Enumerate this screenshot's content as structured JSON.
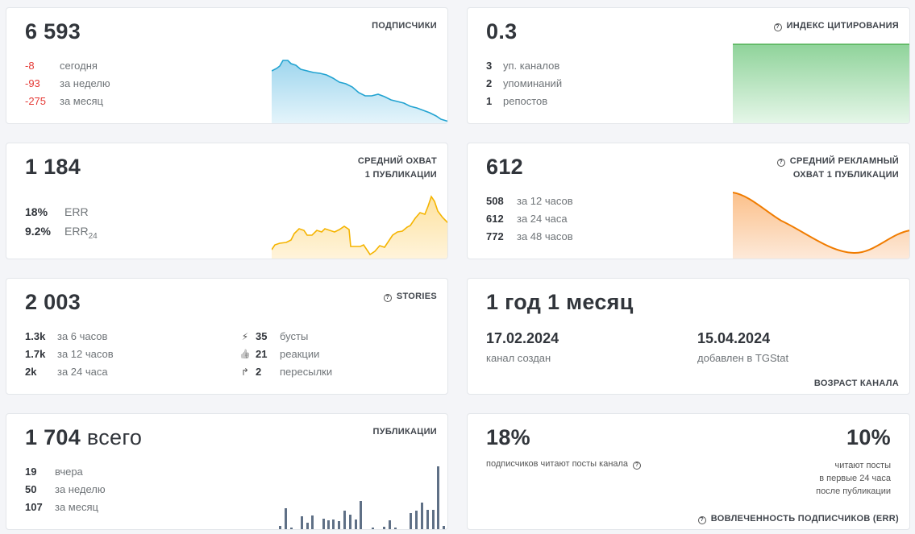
{
  "subscribers": {
    "value": "6 593",
    "label": "ПОДПИСЧИКИ",
    "rows": [
      {
        "n": "-8",
        "t": "сегодня"
      },
      {
        "n": "-93",
        "t": "за неделю"
      },
      {
        "n": "-275",
        "t": "за месяц"
      }
    ],
    "color": "#22a3d1"
  },
  "citation": {
    "value": "0.3",
    "label": "ИНДЕКС ЦИТИРОВАНИЯ",
    "rows": [
      {
        "n": "3",
        "t": "уп. каналов"
      },
      {
        "n": "2",
        "t": "упоминаний"
      },
      {
        "n": "1",
        "t": "репостов"
      }
    ],
    "color": "#4caf50"
  },
  "reach": {
    "value": "1 184",
    "label_line1": "СРЕДНИЙ ОХВАТ",
    "label_line2": "1 ПУБЛИКАЦИИ",
    "rows": [
      {
        "n": "18%",
        "t": "ERR"
      },
      {
        "n": "9.2%",
        "t": "ERR",
        "sub": "24"
      }
    ],
    "color": "#f5b400"
  },
  "ad_reach": {
    "value": "612",
    "label_line1": "СРЕДНИЙ РЕКЛАМНЫЙ",
    "label_line2": "ОХВАТ 1 ПУБЛИКАЦИИ",
    "rows": [
      {
        "n": "508",
        "t": "за 12 часов"
      },
      {
        "n": "612",
        "t": "за 24 часа"
      },
      {
        "n": "772",
        "t": "за 48 часов"
      }
    ],
    "color": "#f07c00"
  },
  "stories": {
    "value": "2 003",
    "label": "STORIES",
    "rows_left": [
      {
        "n": "1.3k",
        "t": "за 6 часов"
      },
      {
        "n": "1.7k",
        "t": "за 12 часов"
      },
      {
        "n": "2k",
        "t": "за 24 часа"
      }
    ],
    "rows_right": [
      {
        "icon": "⚡",
        "icon_name": "lightning-icon",
        "n": "35",
        "t": "бусты"
      },
      {
        "icon": "👍",
        "icon_name": "thumbs-up-icon",
        "n": "21",
        "t": "реакции"
      },
      {
        "icon": "↱",
        "icon_name": "forward-arrow-icon",
        "n": "2",
        "t": "пересылки"
      }
    ]
  },
  "age": {
    "value": "1 год 1 месяц",
    "created_date": "17.02.2024",
    "created_label": "канал создан",
    "added_date": "15.04.2024",
    "added_label": "добавлен в TGStat",
    "label": "ВОЗРАСТ КАНАЛА"
  },
  "posts": {
    "value": "1 704",
    "value_suffix": "всего",
    "label": "ПУБЛИКАЦИИ",
    "rows": [
      {
        "n": "19",
        "t": "вчера"
      },
      {
        "n": "50",
        "t": "за неделю"
      },
      {
        "n": "107",
        "t": "за месяц"
      }
    ],
    "color": "#5f7086"
  },
  "engagement": {
    "left_value": "18%",
    "left_text": "подписчиков читают посты канала",
    "right_value": "10%",
    "right_line1": "читают посты",
    "right_line2": "в первые 24 часа",
    "right_line3": "после публикации",
    "label": "ВОВЛЕЧЕННОСТЬ ПОДПИСЧИКОВ (ERR)"
  }
}
